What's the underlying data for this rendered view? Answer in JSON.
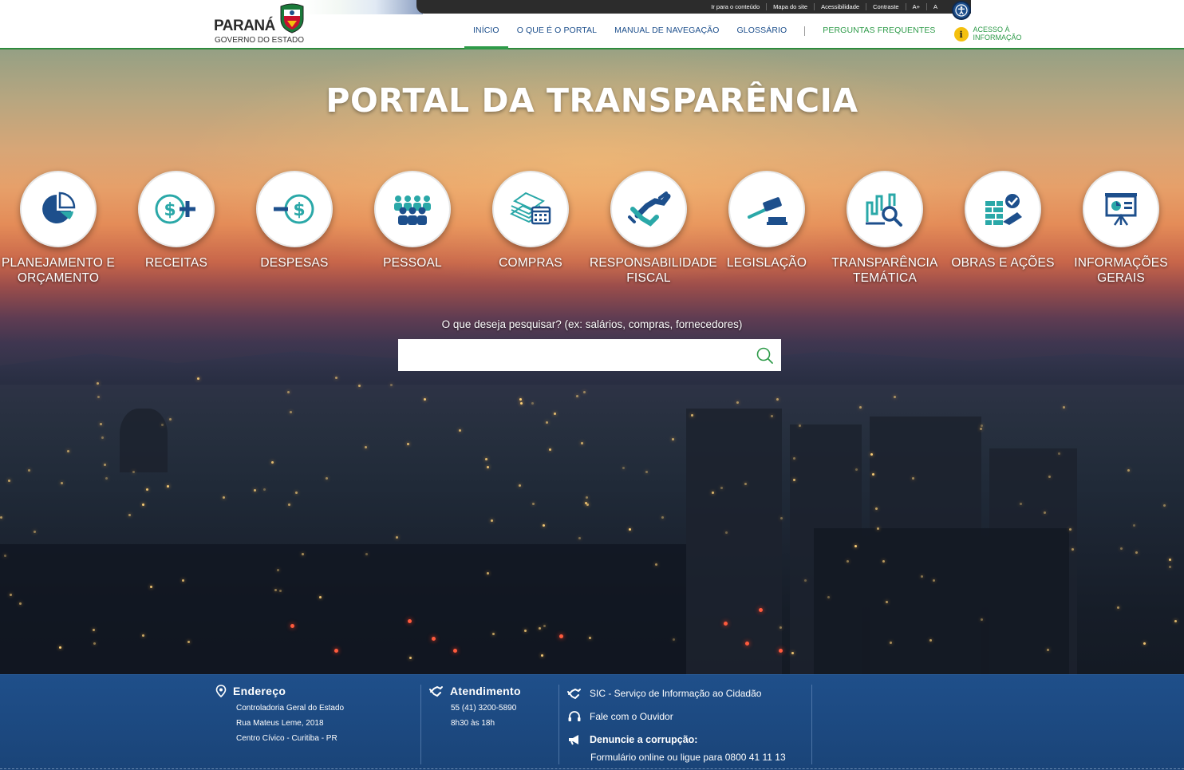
{
  "header": {
    "logo_title": "PARANÁ",
    "logo_subtitle": "GOVERNO DO ESTADO",
    "topbar": [
      "Ir para o conteúdo",
      "Mapa do site",
      "Acessibilidade",
      "Contraste",
      "A+",
      "A"
    ],
    "nav": {
      "inicio": "INÍCIO",
      "o_que_e": "O QUE É O PORTAL",
      "manual": "MANUAL DE NAVEGAÇÃO",
      "glossario": "GLOSSÁRIO",
      "perguntas": "PERGUNTAS FREQUENTES",
      "acesso_line1": "ACESSO À",
      "acesso_line2": "INFORMAÇÃO"
    }
  },
  "hero": {
    "title": "PORTAL DA TRANSPARÊNCIA",
    "categories": [
      {
        "line1": "PLANEJAMENTO E",
        "line2": "ORÇAMENTO",
        "icon": "pie-chart-icon"
      },
      {
        "line1": "RECEITAS",
        "line2": "",
        "icon": "dollar-plus-icon"
      },
      {
        "line1": "DESPESAS",
        "line2": "",
        "icon": "dollar-minus-icon"
      },
      {
        "line1": "PESSOAL",
        "line2": "",
        "icon": "people-group-icon"
      },
      {
        "line1": "COMPRAS",
        "line2": "",
        "icon": "money-calendar-icon"
      },
      {
        "line1": "RESPONSABILIDADE",
        "line2": "FISCAL",
        "icon": "handshake-icon"
      },
      {
        "line1": "LEGISLAÇÃO",
        "line2": "",
        "icon": "gavel-icon"
      },
      {
        "line1": "TRANSPARÊNCIA",
        "line2": "TEMÁTICA",
        "icon": "chart-magnifier-icon"
      },
      {
        "line1": "OBRAS E AÇÕES",
        "line2": "",
        "icon": "construction-check-icon"
      },
      {
        "line1": "INFORMAÇÕES",
        "line2": "GERAIS",
        "icon": "presentation-board-icon"
      }
    ],
    "search_label": "O que deseja pesquisar? (ex: salários, compras, fornecedores)",
    "search_value": ""
  },
  "footer": {
    "endereco": {
      "title": "Endereço",
      "lines": [
        "Controladoria Geral do Estado",
        "Rua Mateus Leme, 2018",
        "Centro Cívico - Curitiba - PR"
      ]
    },
    "atendimento": {
      "title": "Atendimento",
      "lines": [
        "55 (41) 3200-5890",
        "8h30 às 18h"
      ]
    },
    "links": {
      "sic": "SIC - Serviço de Informação ao Cidadão",
      "ouvidor": "Fale com o Ouvidor",
      "denuncie_title": "Denuncie a corrupção:",
      "denuncie_text": "Formulário online ou ligue para 0800 41 11 13"
    }
  },
  "colors": {
    "brand_blue": "#1d4f8c",
    "brand_green": "#2e9b49",
    "icon_teal": "#2aa8a8",
    "footer_blue": "#1f4f8a"
  }
}
